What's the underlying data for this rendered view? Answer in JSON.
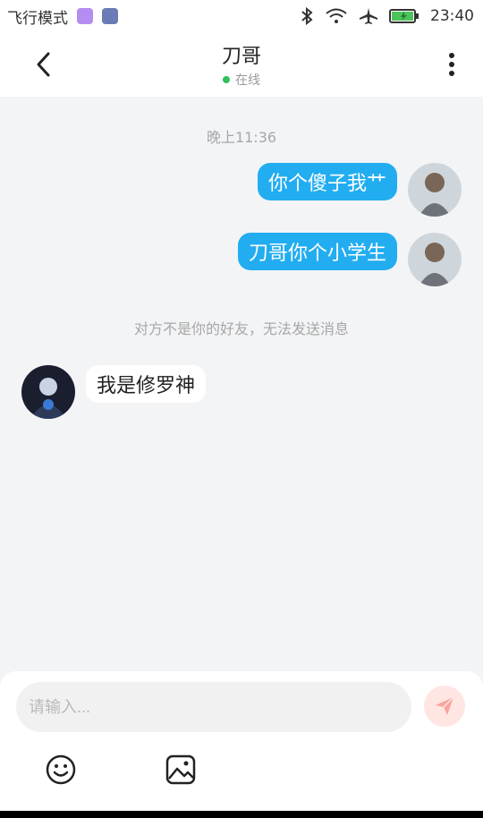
{
  "status_bar": {
    "left_text": "飞行模式",
    "time": "23:40"
  },
  "header": {
    "title": "刀哥",
    "status": "在线"
  },
  "chat": {
    "timestamp": "晚上11:36",
    "messages": [
      {
        "from": "me",
        "text": "你个傻子我艹"
      },
      {
        "from": "me",
        "text": "刀哥你个小学生"
      }
    ],
    "system_note": "对方不是你的好友，无法发送消息",
    "incoming": [
      {
        "from": "other",
        "text": "我是修罗神"
      }
    ]
  },
  "composer": {
    "placeholder": "请输入..."
  },
  "colors": {
    "accent": "#22adf1",
    "online": "#2fc05a",
    "send_bg": "#ffe6e2"
  },
  "icons": [
    "back-arrow-icon",
    "more-vert-icon",
    "emoji-icon",
    "image-icon",
    "send-icon",
    "bluetooth-icon",
    "wifi-icon",
    "airplane-icon",
    "battery-icon"
  ]
}
